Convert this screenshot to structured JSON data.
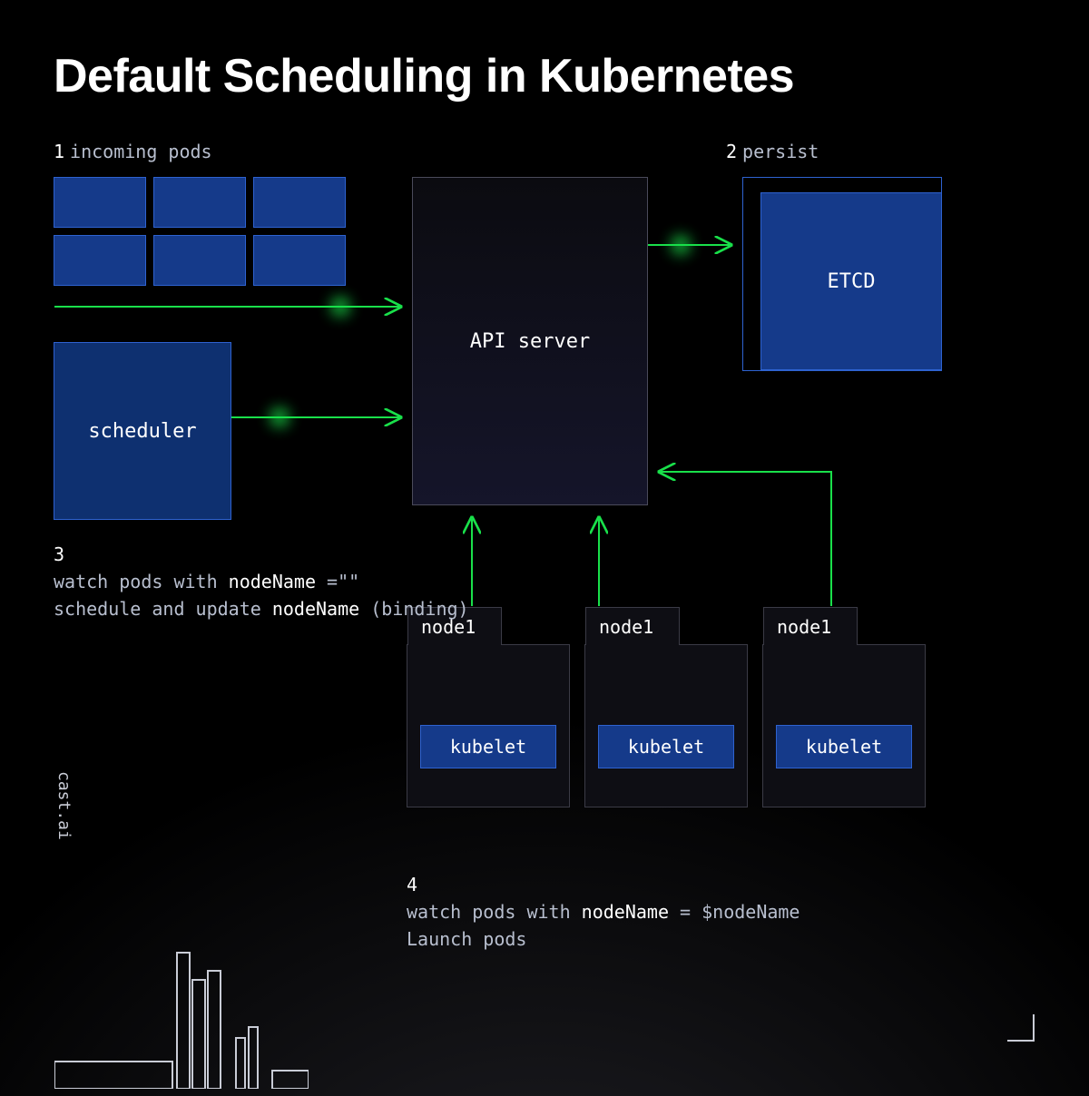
{
  "title": "Default Scheduling in Kubernetes",
  "step1": {
    "num": "1",
    "label": "incoming pods"
  },
  "step2": {
    "num": "2",
    "label": "persist"
  },
  "scheduler": {
    "label": "scheduler"
  },
  "api": {
    "label": "API server"
  },
  "etcd": {
    "label": "ETCD"
  },
  "nodes": [
    {
      "name": "node1",
      "kubelet": "kubelet"
    },
    {
      "name": "node1",
      "kubelet": "kubelet"
    },
    {
      "name": "node1",
      "kubelet": "kubelet"
    }
  ],
  "step3": {
    "num": "3",
    "line1_a": "watch pods with ",
    "line1_b": "nodeName",
    "line1_c": " =\"\"",
    "line2_a": "schedule and update ",
    "line2_b": "nodeName",
    "line2_c": " (binding)"
  },
  "step4": {
    "num": "4",
    "line1_a": "watch pods with ",
    "line1_b": "nodeName",
    "line1_c": " = $nodeName",
    "line2": "Launch pods"
  },
  "brand": "cast.ai"
}
